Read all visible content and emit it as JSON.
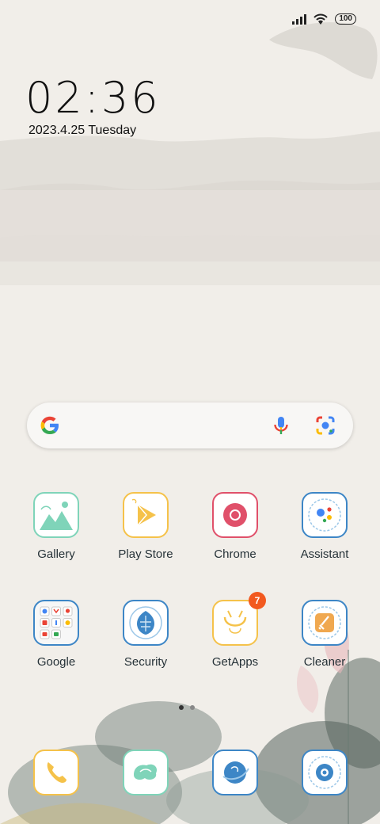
{
  "status_bar": {
    "battery": "100",
    "icons": [
      "signal-icon",
      "wifi-icon",
      "battery-icon"
    ]
  },
  "clock": {
    "time": "02:36",
    "date": "2023.4.25 Tuesday"
  },
  "search_bar": {
    "icons": [
      "google-g-icon",
      "mic-icon",
      "google-lens-icon"
    ]
  },
  "apps_row1": [
    {
      "label": "Gallery",
      "icon": "gallery-icon"
    },
    {
      "label": "Play Store",
      "icon": "play-store-icon"
    },
    {
      "label": "Chrome",
      "icon": "chrome-icon"
    },
    {
      "label": "Assistant",
      "icon": "assistant-icon"
    }
  ],
  "apps_row2": [
    {
      "label": "Google",
      "icon": "google-folder-icon"
    },
    {
      "label": "Security",
      "icon": "security-icon"
    },
    {
      "label": "GetApps",
      "icon": "getapps-icon",
      "badge": "7"
    },
    {
      "label": "Cleaner",
      "icon": "cleaner-icon"
    }
  ],
  "dock": [
    {
      "icon": "phone-icon"
    },
    {
      "icon": "messages-icon"
    },
    {
      "icon": "browser-icon"
    },
    {
      "icon": "camera-icon"
    }
  ],
  "page_indicator": {
    "pages": 2,
    "active": 1
  },
  "colors": {
    "wallpaper": "#f1eee9",
    "badge": "#f2591f",
    "label_text": "#263238"
  }
}
